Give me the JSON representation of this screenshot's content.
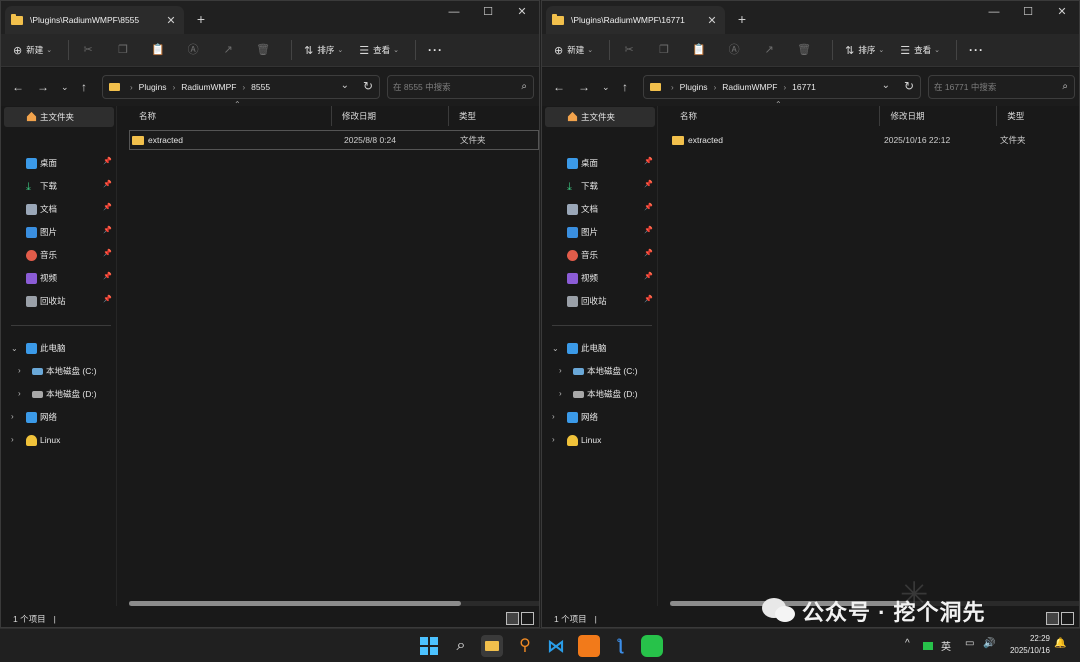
{
  "windows": [
    {
      "tab_title": "\\Plugins\\RadiumWMPF\\8555",
      "toolbar": {
        "new_label": "新建",
        "sort_label": "排序",
        "view_label": "查看"
      },
      "breadcrumbs": [
        "Plugins",
        "RadiumWMPF",
        "8555"
      ],
      "search_placeholder": "在 8555 中搜索",
      "columns": {
        "name": "名称",
        "date": "修改日期",
        "type": "类型"
      },
      "files": [
        {
          "name": "extracted",
          "date": "2025/8/8 0:24",
          "type": "文件夹",
          "selected": true
        }
      ],
      "status": "1 个项目"
    },
    {
      "tab_title": "\\Plugins\\RadiumWMPF\\16771",
      "toolbar": {
        "new_label": "新建",
        "sort_label": "排序",
        "view_label": "查看"
      },
      "breadcrumbs": [
        "Plugins",
        "RadiumWMPF",
        "16771"
      ],
      "search_placeholder": "在 16771 中搜索",
      "columns": {
        "name": "名称",
        "date": "修改日期",
        "type": "类型"
      },
      "files": [
        {
          "name": "extracted",
          "date": "2025/10/16 22:12",
          "type": "文件夹",
          "selected": false
        }
      ],
      "status": "1 个项目"
    }
  ],
  "sidebar": {
    "home": "主文件夹",
    "quick_access": [
      {
        "label": "桌面",
        "icon": "desktop-icon",
        "color": "#3b9ae8"
      },
      {
        "label": "下载",
        "icon": "download-icon",
        "color": "#3bc47e"
      },
      {
        "label": "文档",
        "icon": "document-icon",
        "color": "#9aa7b8"
      },
      {
        "label": "图片",
        "icon": "pictures-icon",
        "color": "#3a8fe0"
      },
      {
        "label": "音乐",
        "icon": "music-icon",
        "color": "#e25c4a"
      },
      {
        "label": "视频",
        "icon": "video-icon",
        "color": "#8b5cd6"
      },
      {
        "label": "回收站",
        "icon": "recycle-bin-icon",
        "color": "#9aa0a8"
      }
    ],
    "this_pc": "此电脑",
    "drives": [
      "本地磁盘 (C:)",
      "本地磁盘 (D:)"
    ],
    "network": "网络",
    "linux": "Linux"
  },
  "taskbar": {
    "tray_lang": "英",
    "time": "22:29",
    "date": "2025/10/16"
  },
  "watermark": "公众号 · 挖个洞先"
}
